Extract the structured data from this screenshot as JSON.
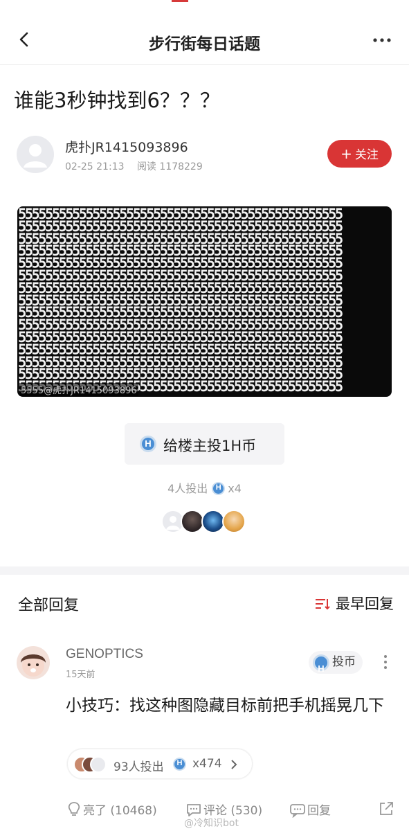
{
  "header": {
    "title": "步行街每日话题"
  },
  "post": {
    "title": "谁能3秒钟找到6？？？",
    "author": "虎扑JR1415093896",
    "date": "02-25 21:13",
    "reads": "阅读 1178229",
    "follow_label": "关注",
    "puzzle_digit_text": "555555555555555555555555555555555555555555555555",
    "puzzle_rows": 15,
    "hidden_digit": "6",
    "watermark": "5555@虎扑JR1415093896"
  },
  "coins": {
    "button_label": "给楼主投1H币",
    "icon_letter": "H",
    "summary_prefix": "4人投出",
    "summary_mult": "x4"
  },
  "replies": {
    "title": "全部回复",
    "sort_label": "最早回复",
    "items": [
      {
        "user": "GENOPTICS",
        "time": "15天前",
        "tip_label": "投币",
        "text": "小技巧：找这种图隐藏目标前把手机摇晃几下",
        "coins_label": "93人投出",
        "coins_mult": "x474"
      }
    ]
  },
  "actions": {
    "light": "亮了 (10468)",
    "comment": "评论 (530)",
    "reply": "回复"
  },
  "weibo_watermark": "@冷知识bot",
  "colors": {
    "accent_red": "#d93535",
    "coin_blue": "#4a8ed4",
    "muted_text": "#9a9a9a"
  }
}
